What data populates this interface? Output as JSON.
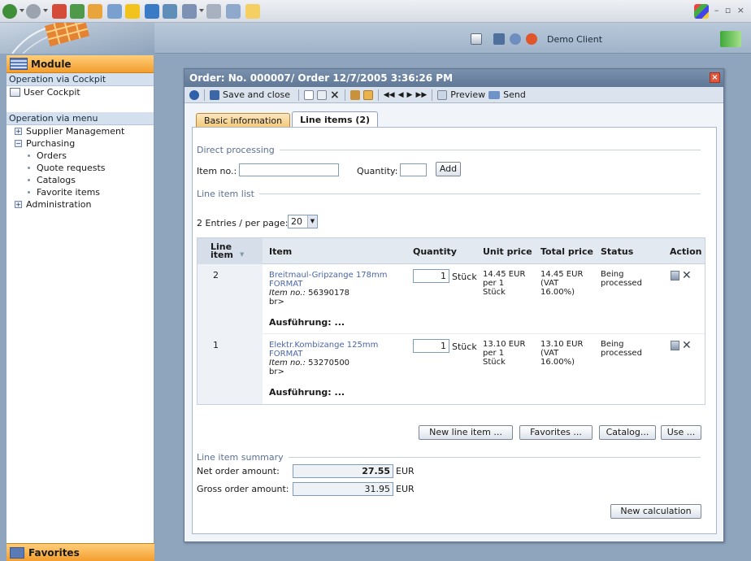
{
  "header": {
    "client_name": "Demo Client"
  },
  "sidebar": {
    "module_title": "Module",
    "section_cockpit": "Operation via Cockpit",
    "cockpit_item": "User Cockpit",
    "section_menu": "Operation via menu",
    "menu": [
      {
        "label": "Supplier Management",
        "type": "group",
        "state": "collapsed"
      },
      {
        "label": "Purchasing",
        "type": "group",
        "state": "expanded"
      },
      {
        "label": "Orders",
        "type": "sub"
      },
      {
        "label": "Quote requests",
        "type": "sub"
      },
      {
        "label": "Catalogs",
        "type": "sub"
      },
      {
        "label": "Favorite items",
        "type": "sub"
      },
      {
        "label": "Administration",
        "type": "group",
        "state": "collapsed"
      }
    ],
    "favorites_title": "Favorites"
  },
  "dialog": {
    "title": "Order: No. 000007/ Order 12/7/2005 3:36:26 PM",
    "close_symbol": "×",
    "toolbar": {
      "save_close": "Save and close",
      "preview": "Preview",
      "send": "Send"
    },
    "tabs": [
      {
        "label": "Basic information",
        "active": false
      },
      {
        "label": "Line items (2)",
        "active": true
      }
    ]
  },
  "direct": {
    "legend": "Direct processing",
    "item_no_label": "Item no.:",
    "item_no_value": "",
    "quantity_label": "Quantity:",
    "quantity_value": "",
    "add_button": "Add"
  },
  "list": {
    "legend": "Line item list",
    "entries_per_page": "2 Entries / per page:",
    "per_page_value": "20",
    "columns": {
      "line_item": "Line item",
      "item": "Item",
      "quantity": "Quantity",
      "unit_price": "Unit price",
      "total_price": "Total price",
      "status": "Status",
      "action": "Action"
    },
    "rows": [
      {
        "line_no": "2",
        "name_line1": "Breitmaul-Gripzange 178mm",
        "name_line2": "FORMAT",
        "item_no_label": "Item no.:",
        "item_no": "56390178",
        "extra": "br>",
        "ausfuehrung": "Ausführung: ...",
        "qty": "1",
        "unit": "Stück",
        "unit_price_1": "14.45 EUR",
        "unit_price_2": "per 1",
        "unit_price_3": "Stück",
        "total_1": "14.45 EUR",
        "total_2": "(VAT",
        "total_3": "16.00%)",
        "status_1": "Being",
        "status_2": "processed"
      },
      {
        "line_no": "1",
        "name_line1": "Elektr.Kombizange 125mm",
        "name_line2": "FORMAT",
        "item_no_label": "Item no.:",
        "item_no": "53270500",
        "extra": "br>",
        "ausfuehrung": "Ausführung: ...",
        "qty": "1",
        "unit": "Stück",
        "unit_price_1": "13.10 EUR",
        "unit_price_2": "per 1",
        "unit_price_3": "Stück",
        "total_1": "13.10 EUR",
        "total_2": "(VAT",
        "total_3": "16.00%)",
        "status_1": "Being",
        "status_2": "processed"
      }
    ],
    "buttons": {
      "new_line_item": "New line item ...",
      "favorites": "Favorites ...",
      "catalog": "Catalog...",
      "use": "Use ..."
    }
  },
  "summary": {
    "legend": "Line item summary",
    "net_label": "Net order amount:",
    "net_value": "27.55",
    "gross_label": "Gross order amount:",
    "gross_value": "31.95",
    "currency": "EUR",
    "new_calc": "New calculation"
  }
}
